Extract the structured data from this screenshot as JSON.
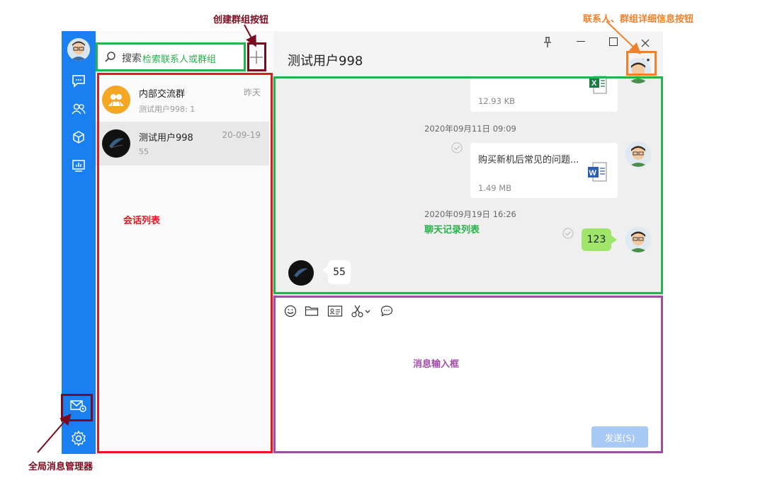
{
  "annotations": {
    "create_group_button": "创建群组按钮",
    "contact_group_detail_button": "联系人、群组详细信息按钮",
    "conversation_list": "会话列表",
    "chat_record_list": "聊天记录列表",
    "message_input_box": "消息输入框",
    "global_message_manager": "全局消息管理器"
  },
  "search": {
    "prefix": "搜索",
    "placeholder": "检索联系人或群组"
  },
  "conversations": [
    {
      "name": "内部交流群",
      "time": "昨天",
      "preview": "测试用户998: 1"
    },
    {
      "name": "测试用户998",
      "time": "20-09-19",
      "preview": "55"
    }
  ],
  "chat": {
    "title": "测试用户998",
    "messages": {
      "file1_size": "12.93 KB",
      "timestamp1": "2020年09月11日 09:09",
      "file2_name": "购买新机后常见的问题...",
      "file2_size": "1.49 MB",
      "timestamp2": "2020年09月19日 16:26",
      "own_text": "123",
      "incoming_text": "55"
    },
    "send_label": "发送(S)"
  },
  "colors": {
    "sidebar": "#1a7ff0",
    "red": "#e8161f",
    "green": "#25b34b",
    "purple": "#a44ba9",
    "dark_red": "#7a0b1e",
    "orange": "#f0812b",
    "own_bubble": "#9ee56a",
    "send_disabled": "#a8c8f5"
  }
}
